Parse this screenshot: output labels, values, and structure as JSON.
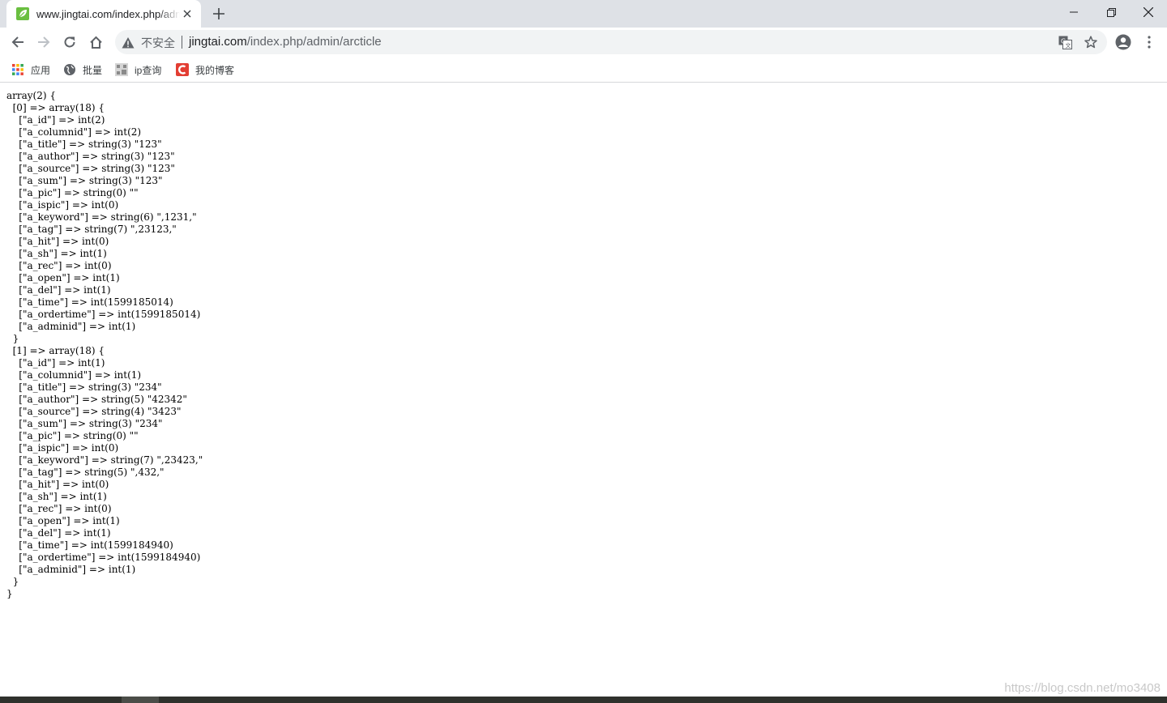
{
  "browser": {
    "tab": {
      "title": "www.jingtai.com/index.php/admin/arcticle",
      "favicon": "leaf-icon",
      "close_icon": "close-icon"
    },
    "new_tab_icon": "plus-icon",
    "window_controls": [
      "minimize-icon",
      "restore-icon",
      "close-icon"
    ],
    "toolbar": {
      "back_icon": "back-arrow-icon",
      "forward_icon": "forward-arrow-icon",
      "reload_icon": "reload-icon",
      "home_icon": "home-icon"
    },
    "omnibox": {
      "security_label": "不安全",
      "url_host": "jingtai.com",
      "url_path": "/index.php/admin/arcticle",
      "translate_icon": "translate-icon",
      "bookmark_icon": "star-icon"
    },
    "profile_icon": "account-icon",
    "menu_icon": "kebab-menu-icon",
    "bookmarks": [
      {
        "label": "应用",
        "icon": "apps-grid-icon"
      },
      {
        "label": "批量",
        "icon": "globe-icon"
      },
      {
        "label": "ip查询",
        "icon": "ip-query-icon"
      },
      {
        "label": "我的博客",
        "icon": "csdn-icon"
      }
    ]
  },
  "page": {
    "dump_text": "array(2) {\n  [0] => array(18) {\n    [\"a_id\"] => int(2)\n    [\"a_columnid\"] => int(2)\n    [\"a_title\"] => string(3) \"123\"\n    [\"a_author\"] => string(3) \"123\"\n    [\"a_source\"] => string(3) \"123\"\n    [\"a_sum\"] => string(3) \"123\"\n    [\"a_pic\"] => string(0) \"\"\n    [\"a_ispic\"] => int(0)\n    [\"a_keyword\"] => string(6) \",1231,\"\n    [\"a_tag\"] => string(7) \",23123,\"\n    [\"a_hit\"] => int(0)\n    [\"a_sh\"] => int(1)\n    [\"a_rec\"] => int(0)\n    [\"a_open\"] => int(1)\n    [\"a_del\"] => int(1)\n    [\"a_time\"] => int(1599185014)\n    [\"a_ordertime\"] => int(1599185014)\n    [\"a_adminid\"] => int(1)\n  }\n  [1] => array(18) {\n    [\"a_id\"] => int(1)\n    [\"a_columnid\"] => int(1)\n    [\"a_title\"] => string(3) \"234\"\n    [\"a_author\"] => string(5) \"42342\"\n    [\"a_source\"] => string(4) \"3423\"\n    [\"a_sum\"] => string(3) \"234\"\n    [\"a_pic\"] => string(0) \"\"\n    [\"a_ispic\"] => int(0)\n    [\"a_keyword\"] => string(7) \",23423,\"\n    [\"a_tag\"] => string(5) \",432,\"\n    [\"a_hit\"] => int(0)\n    [\"a_sh\"] => int(1)\n    [\"a_rec\"] => int(0)\n    [\"a_open\"] => int(1)\n    [\"a_del\"] => int(1)\n    [\"a_time\"] => int(1599184940)\n    [\"a_ordertime\"] => int(1599184940)\n    [\"a_adminid\"] => int(1)\n  }\n}",
    "watermark": "https://blog.csdn.net/mo3408"
  },
  "colors": {
    "tabstrip_bg": "#dee1e6",
    "omnibox_bg": "#f1f3f4",
    "taskbar_bg": "#2f312c",
    "favicon_green": "#6abf40",
    "csdn_red": "#e33e33"
  }
}
